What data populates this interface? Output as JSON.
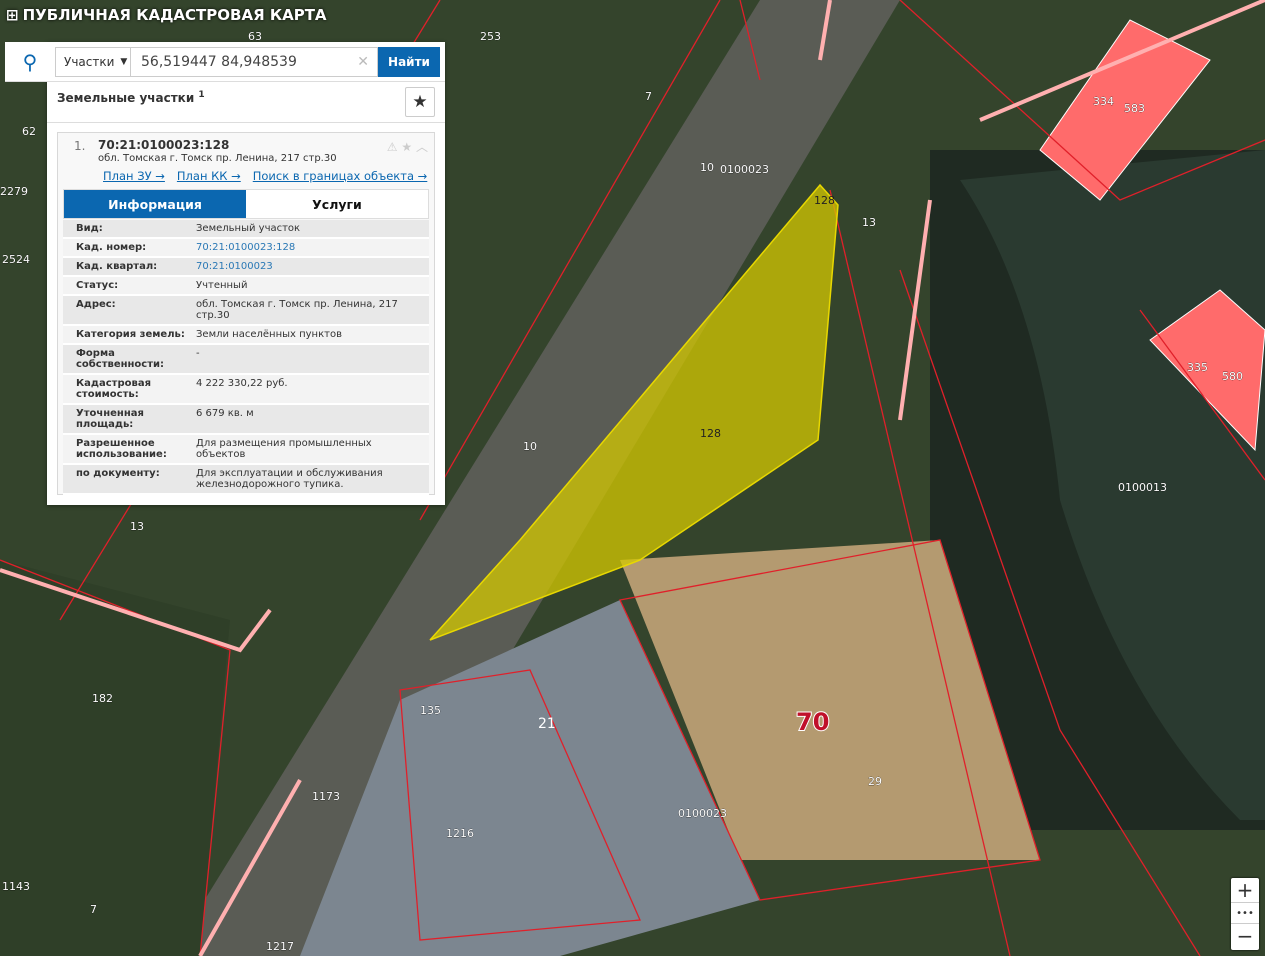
{
  "header": {
    "title": "ПУБЛИЧНАЯ КАДАСТРОВАЯ КАРТА"
  },
  "search": {
    "type_select": "Участки",
    "query": "56,519447 84,948539",
    "submit_label": "Найти"
  },
  "results": {
    "heading": "Земельные участки",
    "count": "1"
  },
  "parcel": {
    "index": "1.",
    "cad_number": "70:21:0100023:128",
    "address": "обл. Томская г. Томск пр. Ленина, 217 стр.30",
    "links": [
      "План ЗУ →",
      "План КК →",
      "Поиск в границах объекта →"
    ],
    "tabs": [
      "Информация",
      "Услуги"
    ],
    "fields": [
      {
        "k": "Вид:",
        "v": "Земельный участок"
      },
      {
        "k": "Кад. номер:",
        "v": "70:21:0100023:128",
        "link": true
      },
      {
        "k": "Кад. квартал:",
        "v": "70:21:0100023",
        "link": true
      },
      {
        "k": "Статус:",
        "v": "Учтенный"
      },
      {
        "k": "Адрес:",
        "v": "обл. Томская г. Томск пр. Ленина, 217 стр.30"
      },
      {
        "k": "Категория земель:",
        "v": "Земли населённых пунктов"
      },
      {
        "k": "Форма собственности:",
        "v": "-"
      },
      {
        "k": "Кадастровая стоимость:",
        "v": "4 222 330,22 руб."
      },
      {
        "k": "Уточненная площадь:",
        "v": "6 679 кв. м"
      },
      {
        "k": "Разрешенное использование:",
        "v": "Для размещения промышленных объектов"
      },
      {
        "k": "по документу:",
        "v": "Для эксплуатации и обслуживания железнодорожного тупика."
      }
    ]
  },
  "map": {
    "labels": [
      "253",
      "63",
      "7",
      "10",
      "0100023",
      "13",
      "128",
      "128",
      "10",
      "334",
      "583",
      "335",
      "580",
      "0100013",
      "62",
      "2279",
      "2524",
      "13",
      "182",
      "135",
      "21",
      "70",
      "29",
      "0100023",
      "1216",
      "1173",
      "1143",
      "7",
      "1217"
    ],
    "highlight_color": "#d4c800",
    "boundary_color": "#e0202a"
  },
  "controls": {
    "zoom_in": "+",
    "more": "•••",
    "zoom_out": "−"
  }
}
